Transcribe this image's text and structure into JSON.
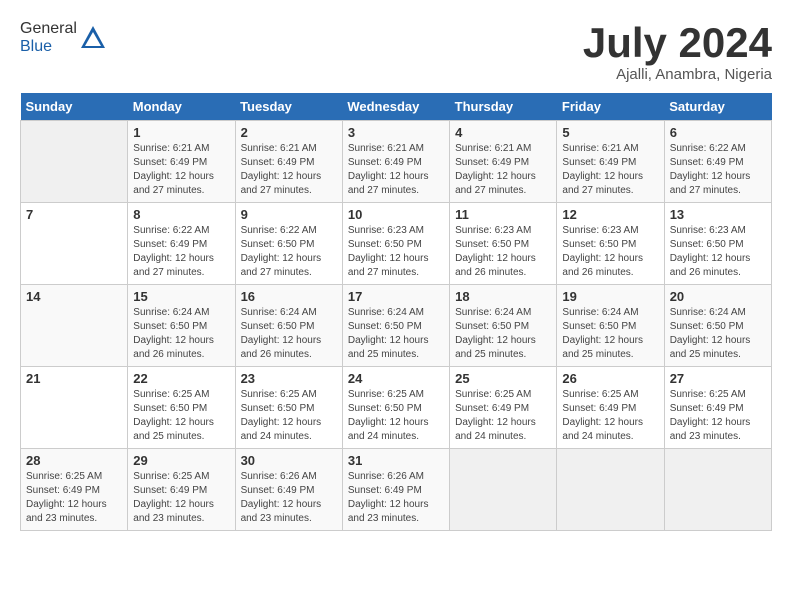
{
  "header": {
    "logo_general": "General",
    "logo_blue": "Blue",
    "title": "July 2024",
    "subtitle": "Ajalli, Anambra, Nigeria"
  },
  "calendar": {
    "days_of_week": [
      "Sunday",
      "Monday",
      "Tuesday",
      "Wednesday",
      "Thursday",
      "Friday",
      "Saturday"
    ],
    "weeks": [
      [
        {
          "day": "",
          "info": ""
        },
        {
          "day": "1",
          "info": "Sunrise: 6:21 AM\nSunset: 6:49 PM\nDaylight: 12 hours\nand 27 minutes."
        },
        {
          "day": "2",
          "info": "Sunrise: 6:21 AM\nSunset: 6:49 PM\nDaylight: 12 hours\nand 27 minutes."
        },
        {
          "day": "3",
          "info": "Sunrise: 6:21 AM\nSunset: 6:49 PM\nDaylight: 12 hours\nand 27 minutes."
        },
        {
          "day": "4",
          "info": "Sunrise: 6:21 AM\nSunset: 6:49 PM\nDaylight: 12 hours\nand 27 minutes."
        },
        {
          "day": "5",
          "info": "Sunrise: 6:21 AM\nSunset: 6:49 PM\nDaylight: 12 hours\nand 27 minutes."
        },
        {
          "day": "6",
          "info": "Sunrise: 6:22 AM\nSunset: 6:49 PM\nDaylight: 12 hours\nand 27 minutes."
        }
      ],
      [
        {
          "day": "7",
          "info": ""
        },
        {
          "day": "8",
          "info": "Sunrise: 6:22 AM\nSunset: 6:49 PM\nDaylight: 12 hours\nand 27 minutes."
        },
        {
          "day": "9",
          "info": "Sunrise: 6:22 AM\nSunset: 6:50 PM\nDaylight: 12 hours\nand 27 minutes."
        },
        {
          "day": "10",
          "info": "Sunrise: 6:23 AM\nSunset: 6:50 PM\nDaylight: 12 hours\nand 27 minutes."
        },
        {
          "day": "11",
          "info": "Sunrise: 6:23 AM\nSunset: 6:50 PM\nDaylight: 12 hours\nand 26 minutes."
        },
        {
          "day": "12",
          "info": "Sunrise: 6:23 AM\nSunset: 6:50 PM\nDaylight: 12 hours\nand 26 minutes."
        },
        {
          "day": "13",
          "info": "Sunrise: 6:23 AM\nSunset: 6:50 PM\nDaylight: 12 hours\nand 26 minutes."
        }
      ],
      [
        {
          "day": "14",
          "info": ""
        },
        {
          "day": "15",
          "info": "Sunrise: 6:24 AM\nSunset: 6:50 PM\nDaylight: 12 hours\nand 26 minutes."
        },
        {
          "day": "16",
          "info": "Sunrise: 6:24 AM\nSunset: 6:50 PM\nDaylight: 12 hours\nand 26 minutes."
        },
        {
          "day": "17",
          "info": "Sunrise: 6:24 AM\nSunset: 6:50 PM\nDaylight: 12 hours\nand 25 minutes."
        },
        {
          "day": "18",
          "info": "Sunrise: 6:24 AM\nSunset: 6:50 PM\nDaylight: 12 hours\nand 25 minutes."
        },
        {
          "day": "19",
          "info": "Sunrise: 6:24 AM\nSunset: 6:50 PM\nDaylight: 12 hours\nand 25 minutes."
        },
        {
          "day": "20",
          "info": "Sunrise: 6:24 AM\nSunset: 6:50 PM\nDaylight: 12 hours\nand 25 minutes."
        }
      ],
      [
        {
          "day": "21",
          "info": ""
        },
        {
          "day": "22",
          "info": "Sunrise: 6:25 AM\nSunset: 6:50 PM\nDaylight: 12 hours\nand 25 minutes."
        },
        {
          "day": "23",
          "info": "Sunrise: 6:25 AM\nSunset: 6:50 PM\nDaylight: 12 hours\nand 24 minutes."
        },
        {
          "day": "24",
          "info": "Sunrise: 6:25 AM\nSunset: 6:50 PM\nDaylight: 12 hours\nand 24 minutes."
        },
        {
          "day": "25",
          "info": "Sunrise: 6:25 AM\nSunset: 6:49 PM\nDaylight: 12 hours\nand 24 minutes."
        },
        {
          "day": "26",
          "info": "Sunrise: 6:25 AM\nSunset: 6:49 PM\nDaylight: 12 hours\nand 24 minutes."
        },
        {
          "day": "27",
          "info": "Sunrise: 6:25 AM\nSunset: 6:49 PM\nDaylight: 12 hours\nand 23 minutes."
        }
      ],
      [
        {
          "day": "28",
          "info": "Sunrise: 6:25 AM\nSunset: 6:49 PM\nDaylight: 12 hours\nand 23 minutes."
        },
        {
          "day": "29",
          "info": "Sunrise: 6:25 AM\nSunset: 6:49 PM\nDaylight: 12 hours\nand 23 minutes."
        },
        {
          "day": "30",
          "info": "Sunrise: 6:26 AM\nSunset: 6:49 PM\nDaylight: 12 hours\nand 23 minutes."
        },
        {
          "day": "31",
          "info": "Sunrise: 6:26 AM\nSunset: 6:49 PM\nDaylight: 12 hours\nand 23 minutes."
        },
        {
          "day": "",
          "info": ""
        },
        {
          "day": "",
          "info": ""
        },
        {
          "day": "",
          "info": ""
        }
      ]
    ]
  }
}
